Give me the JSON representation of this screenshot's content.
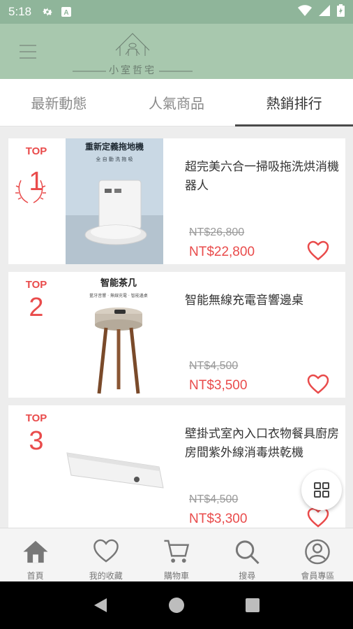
{
  "status": {
    "time": "5:18"
  },
  "header": {
    "logo_text": "小室哲宅"
  },
  "tabs": [
    {
      "label": "最新動態"
    },
    {
      "label": "人氣商品"
    },
    {
      "label": "熱銷排行"
    }
  ],
  "products": [
    {
      "rank_label": "TOP",
      "rank": "1",
      "name": "超完美六合一掃吸拖洗烘消機器人",
      "price_old": "NT$26,800",
      "price_new": "NT$22,800",
      "image_caption": "重新定義拖地機",
      "image_sub": "全 自 動 洗 拖 吸"
    },
    {
      "rank_label": "TOP",
      "rank": "2",
      "name": "智能無線充電音響邊桌",
      "price_old": "NT$4,500",
      "price_new": "NT$3,500",
      "image_caption": "智能茶几",
      "image_sub": "藍牙音響 · 無線充電 · 智能邊桌"
    },
    {
      "rank_label": "TOP",
      "rank": "3",
      "name": "壁掛式室內入口衣物餐具廚房房間紫外線消毒烘乾機",
      "price_old": "NT$4,500",
      "price_new": "NT$3,300"
    }
  ],
  "bottom_nav": [
    {
      "label": "首頁",
      "icon": "home-icon"
    },
    {
      "label": "我的收藏",
      "icon": "heart-icon"
    },
    {
      "label": "購物車",
      "icon": "cart-icon"
    },
    {
      "label": "搜尋",
      "icon": "search-icon"
    },
    {
      "label": "會員專區",
      "icon": "user-icon"
    }
  ],
  "colors": {
    "accent": "#e94b4b",
    "header": "#a8c8ae",
    "statusbar": "#8fb59a"
  }
}
